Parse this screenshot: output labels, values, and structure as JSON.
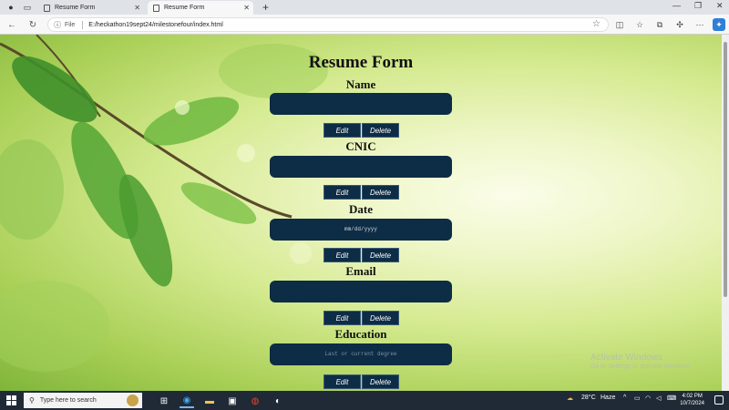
{
  "browser": {
    "tabs": [
      {
        "title": "Resume Form"
      },
      {
        "title": "Resume Form"
      }
    ],
    "url_prefix": "File",
    "url": "E:/heckathon19sept24/milestonefour/index.html"
  },
  "form": {
    "title": "Resume Form",
    "fields": [
      {
        "label": "Name",
        "value": "",
        "placeholder": ""
      },
      {
        "label": "CNIC",
        "value": "",
        "placeholder": ""
      },
      {
        "label": "Date",
        "value": "mm/dd/yyyy",
        "placeholder": ""
      },
      {
        "label": "Email",
        "value": "",
        "placeholder": ""
      },
      {
        "label": "Education",
        "value": "",
        "placeholder": "Last or current degree"
      }
    ],
    "edit_label": "Edit",
    "delete_label": "Delete"
  },
  "watermark": {
    "line1": "Activate Windows",
    "line2": "Go to Settings to activate Windows."
  },
  "taskbar": {
    "search_placeholder": "Type here to search",
    "weather_temp": "28°C",
    "weather_text": "Haze",
    "time": "4:02 PM",
    "date": "10/7/2024"
  },
  "colors": {
    "input_bg": "#0d2c45",
    "button_bg": "#0d2c45",
    "taskbar_bg": "#1f2a36"
  }
}
